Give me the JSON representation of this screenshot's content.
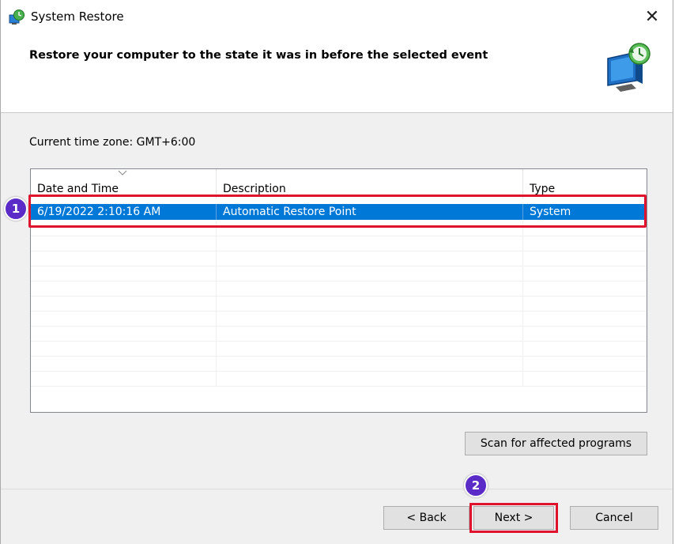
{
  "window": {
    "title": "System Restore",
    "close_glyph": "✕"
  },
  "header": {
    "title": "Restore your computer to the state it was in before the selected event",
    "icon": "system-restore-monitor-icon"
  },
  "timezone_label": "Current time zone: GMT+6:00",
  "table": {
    "columns": [
      "Date and Time",
      "Description",
      "Type"
    ],
    "rows": [
      {
        "date": "6/19/2022 2:10:16 AM",
        "description": "Automatic Restore Point",
        "type": "System",
        "selected": true
      }
    ],
    "empty_rows": 11
  },
  "buttons": {
    "scan": "Scan for affected programs",
    "back": "< Back",
    "next": "Next >",
    "cancel": "Cancel"
  },
  "annotations": {
    "badge1": "1",
    "badge2": "2",
    "highlight_color": "#e0132f",
    "badge_color": "#5b2bc7"
  },
  "colors": {
    "selection": "#0078d7",
    "dialog_bg": "#f0f0f0"
  }
}
